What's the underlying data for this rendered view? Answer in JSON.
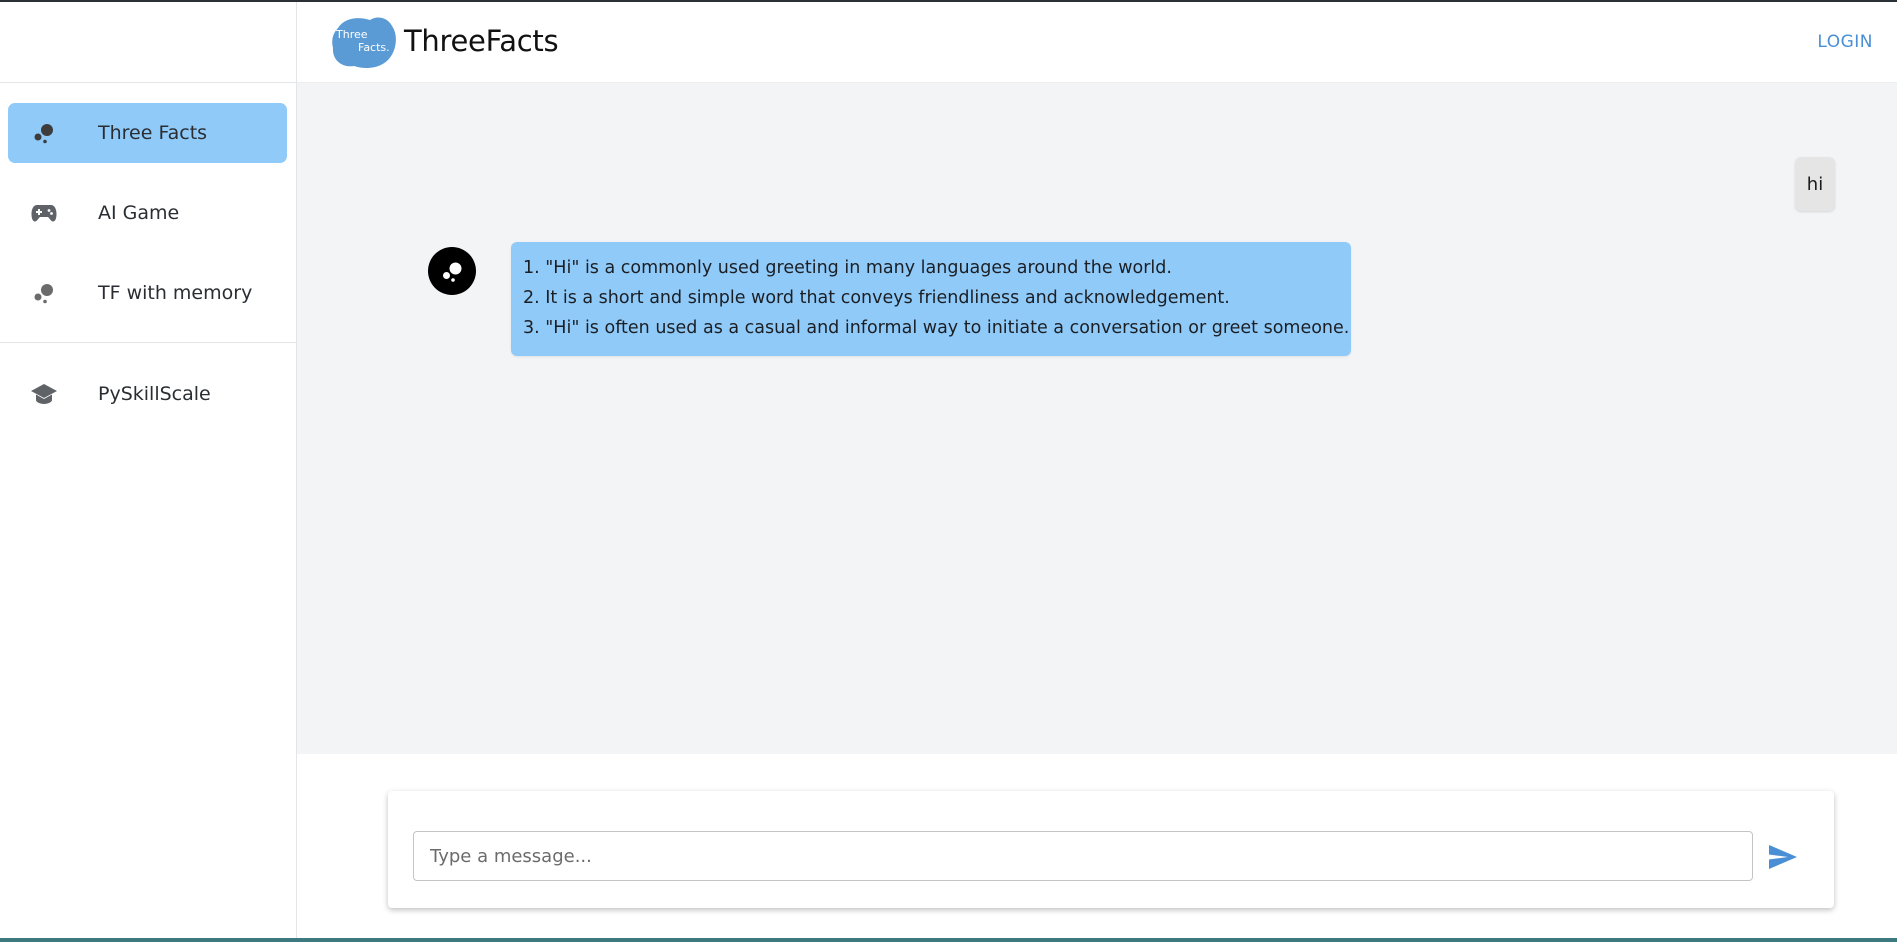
{
  "app": {
    "brand": "ThreeFacts",
    "logo_text_line1": "Three",
    "logo_text_line2": "Facts.",
    "login_label": "LOGIN",
    "accent_color": "#90caf9",
    "link_color": "#4a8fd6"
  },
  "sidebar": {
    "items": [
      {
        "label": "Three Facts",
        "icon": "bubbles-icon",
        "active": true
      },
      {
        "label": "AI Game",
        "icon": "gamepad-icon",
        "active": false
      },
      {
        "label": "TF with memory",
        "icon": "bubbles-icon",
        "active": false
      },
      {
        "label": "PySkillScale",
        "icon": "graduation-cap-icon",
        "active": false
      }
    ]
  },
  "chat": {
    "messages": [
      {
        "role": "user",
        "text": "hi"
      },
      {
        "role": "assistant",
        "lines": [
          "1. \"Hi\" is a commonly used greeting in many languages around the world.",
          "2. It is a short and simple word that conveys friendliness and acknowledgement.",
          "3. \"Hi\" is often used as a casual and informal way to initiate a conversation or greet someone."
        ]
      }
    ]
  },
  "composer": {
    "placeholder": "Type a message...",
    "value": "",
    "send_icon": "send-icon"
  }
}
